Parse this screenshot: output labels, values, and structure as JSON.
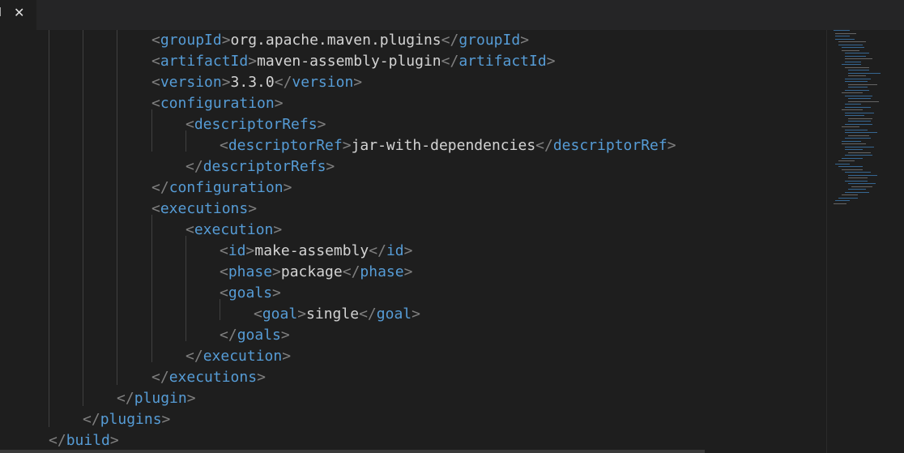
{
  "tab": {
    "name": "l",
    "close_glyph": "✕"
  },
  "code_lines": [
    {
      "tag": "groupId",
      "text": "org.apache.maven.plugins"
    },
    {
      "tag": "artifactId",
      "text": "maven-assembly-plugin"
    },
    {
      "tag": "version",
      "text": "3.3.0"
    },
    {
      "tag": "configuration",
      "kind": "open"
    },
    {
      "tag": "descriptorRefs",
      "kind": "open"
    },
    {
      "tag": "descriptorRef",
      "text": "jar-with-dependencies"
    },
    {
      "tag": "descriptorRefs",
      "kind": "close"
    },
    {
      "tag": "configuration",
      "kind": "close"
    },
    {
      "tag": "executions",
      "kind": "open"
    },
    {
      "tag": "execution",
      "kind": "open"
    },
    {
      "tag": "id",
      "text": "make-assembly"
    },
    {
      "tag": "phase",
      "text": "package"
    },
    {
      "tag": "goals",
      "kind": "open"
    },
    {
      "tag": "goal",
      "text": "single"
    },
    {
      "tag": "goals",
      "kind": "close"
    },
    {
      "tag": "execution",
      "kind": "close"
    },
    {
      "tag": "executions",
      "kind": "close"
    },
    {
      "tag": "plugin",
      "kind": "close"
    },
    {
      "tag": "plugins",
      "kind": "close"
    },
    {
      "tag": "build",
      "kind": "close"
    }
  ],
  "colors": {
    "background": "#1e1e1e",
    "tag": "#569cd6",
    "punctuation": "#808080",
    "text": "#d4d4d4"
  }
}
